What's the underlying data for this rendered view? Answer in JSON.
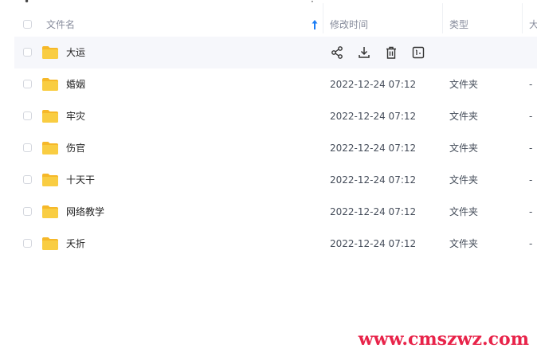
{
  "colors": {
    "accent": "#1a7cf5",
    "folder": "#f9cd42",
    "folder_tab": "#f6b829",
    "hover_row": "#f6f7fb",
    "watermark": "#e8244a"
  },
  "header": {
    "name_label": "文件名",
    "modified_label": "修改时间",
    "type_label": "类型",
    "size_label": "大"
  },
  "rows": [
    {
      "name": "大运",
      "modified": "",
      "type": "",
      "size": "",
      "hovered": true
    },
    {
      "name": "婚姻",
      "modified": "2022-12-24 07:12",
      "type": "文件夹",
      "size": "-"
    },
    {
      "name": "牢灾",
      "modified": "2022-12-24 07:12",
      "type": "文件夹",
      "size": "-"
    },
    {
      "name": "伤官",
      "modified": "2022-12-24 07:12",
      "type": "文件夹",
      "size": "-"
    },
    {
      "name": "十天干",
      "modified": "2022-12-24 07:12",
      "type": "文件夹",
      "size": "-"
    },
    {
      "name": "网络教学",
      "modified": "2022-12-24 07:12",
      "type": "文件夹",
      "size": "-"
    },
    {
      "name": "夭折",
      "modified": "2022-12-24 07:12",
      "type": "文件夹",
      "size": "-"
    }
  ],
  "row_actions": [
    "share-icon",
    "download-icon",
    "delete-icon",
    "more-icon"
  ],
  "watermark": "www.cmszwz.com"
}
